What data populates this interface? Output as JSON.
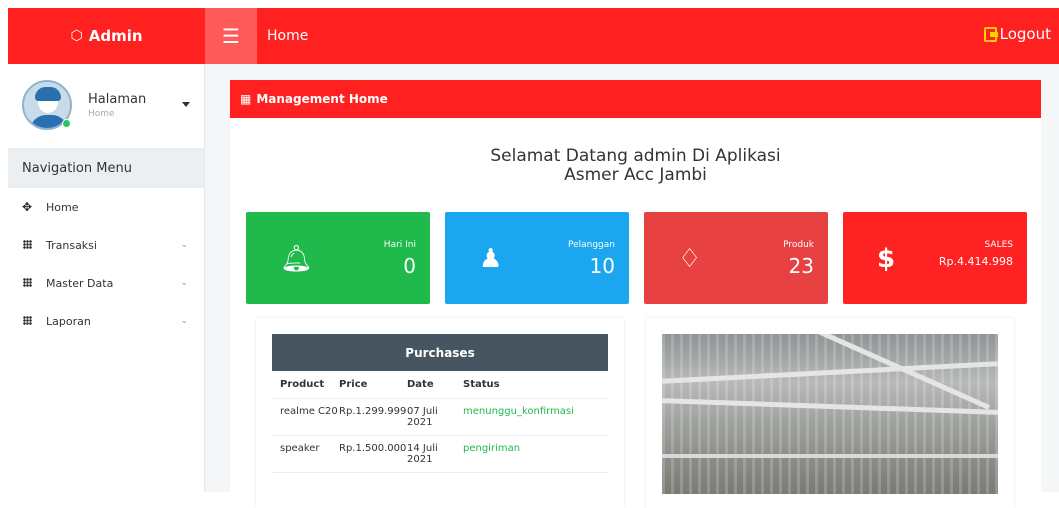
{
  "topbar": {
    "brand": "Admin",
    "page_title": "Home",
    "logout": "Logout"
  },
  "sidebar": {
    "user_name": "Halaman",
    "user_sub": "Home",
    "nav_header": "Navigation Menu",
    "items": [
      {
        "label": "Home",
        "icon": "move-icon"
      },
      {
        "label": "Transaksi",
        "icon": "grid-icon"
      },
      {
        "label": "Master Data",
        "icon": "grid-icon"
      },
      {
        "label": "Laporan",
        "icon": "grid-icon"
      }
    ]
  },
  "panel": {
    "title": "Management Home",
    "welcome_line1": "Selamat Datang admin Di Aplikasi",
    "welcome_line2": "Asmer Acc Jambi"
  },
  "stats": [
    {
      "label": "Hari Ini",
      "value": "0",
      "icon": "bell-icon",
      "color": "#1fba4b"
    },
    {
      "label": "Pelanggan",
      "value": "10",
      "icon": "user-icon",
      "color": "#1ba7f0"
    },
    {
      "label": "Produk",
      "value": "23",
      "icon": "diamond-icon",
      "color": "#e84141"
    },
    {
      "label": "SALES",
      "value": "Rp.4.414.998",
      "icon": "dollar-icon",
      "color": "#ff2222"
    }
  ],
  "purchases": {
    "title": "Purchases",
    "headers": [
      "Product",
      "Price",
      "Date",
      "Status"
    ],
    "rows": [
      {
        "product": "realme C20",
        "price": "Rp.1.299.999",
        "date": "07 Juli 2021",
        "status": "menunggu_konfirmasi"
      },
      {
        "product": "speaker",
        "price": "Rp.1.500.000",
        "date": "14 Juli 2021",
        "status": "pengiriman"
      }
    ]
  }
}
